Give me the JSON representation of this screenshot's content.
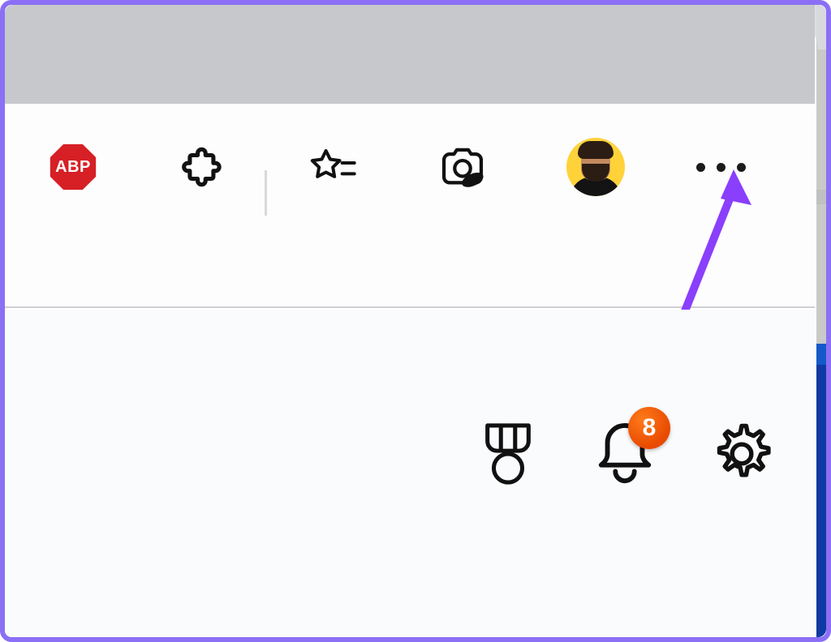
{
  "toolbar": {
    "abp_label": "ABP",
    "icons": {
      "adblock": "abp-icon",
      "extensions": "extensions-icon",
      "favorites": "favorites-icon",
      "screenshot": "screenshot-icon",
      "profile": "profile-avatar",
      "menu": "more-menu-icon"
    }
  },
  "content": {
    "rewards_icon": "rewards-medal-icon",
    "notifications_icon": "bell-icon",
    "notifications_badge": "8",
    "settings_icon": "gear-icon"
  },
  "colors": {
    "frame": "#8b6ff5",
    "tabstrip": "#c7c8cc",
    "abp_red": "#d62025",
    "avatar_bg": "#ffd23a",
    "badge_bg": "#ef5a08",
    "arrow": "#8a3ffc"
  },
  "annotation": {
    "arrow_points_to": "more-menu-button"
  }
}
